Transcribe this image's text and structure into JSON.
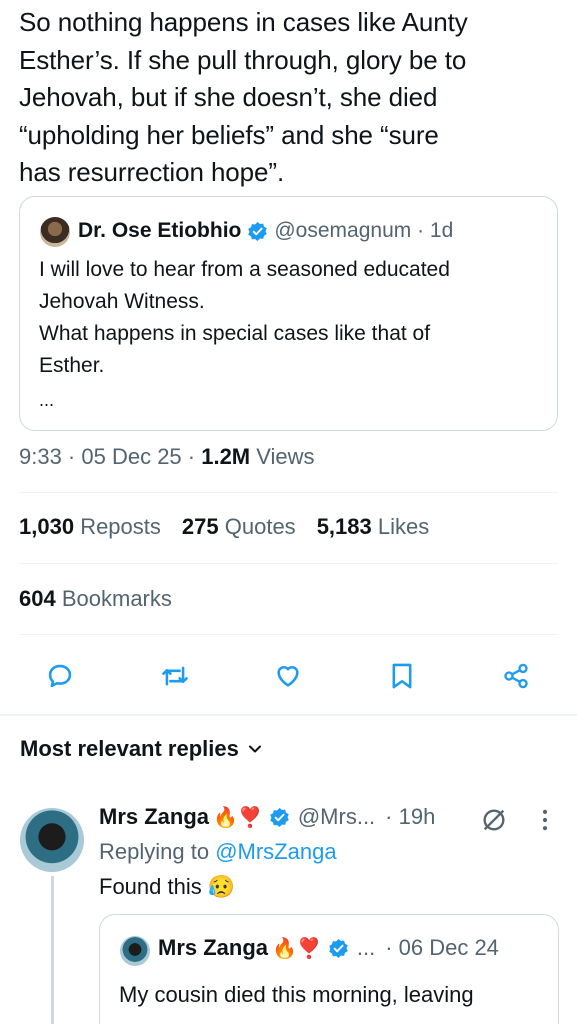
{
  "tweet": {
    "lines": [
      "So nothing happens in cases like Aunty",
      "Esther’s. If she pull through, glory be to",
      "Jehovah, but if she doesn’t, she died",
      "“upholding her beliefs” and she “sure",
      "has resurrection hope”."
    ]
  },
  "quoted": {
    "name": "Dr. Ose Etiobhio",
    "handle": "@osemagnum · 1d",
    "lines": [
      "I will love to hear from a seasoned educated",
      "Jehovah Witness.",
      "What happens in special cases like  that of",
      "Esther."
    ],
    "ellipsis": "..."
  },
  "meta": {
    "time_date": "9:33 · 05 Dec 25 · ",
    "views_count": "1.2M",
    "views_label": " Views"
  },
  "stats": {
    "reposts_count": "1,030",
    "reposts_label": "Reposts",
    "quotes_count": "275",
    "quotes_label": "Quotes",
    "likes_count": "5,183",
    "likes_label": "Likes",
    "bookmarks_count": "604",
    "bookmarks_label": "Bookmarks"
  },
  "actions": [
    "reply-icon",
    "repost-icon",
    "like-icon",
    "bookmark-icon",
    "share-icon"
  ],
  "replies": {
    "header": "Most relevant replies"
  },
  "reply": {
    "name": "Mrs Zanga",
    "emojis": "🔥❣️",
    "handle": "@Mrs...",
    "time": "· 19h",
    "replying_prefix": "Replying to ",
    "replying_to": "@MrsZanga",
    "text": "Found this 😥"
  },
  "inner_quote": {
    "name": "Mrs Zanga",
    "emojis": "🔥❣️",
    "handle": "...",
    "time": "· 06 Dec 24",
    "line1": "My cousin died this morning, leaving"
  },
  "colors": {
    "text": "#0f1419",
    "secondary": "#536471",
    "accent": "#1d9bf0",
    "border": "#cfd9de"
  }
}
